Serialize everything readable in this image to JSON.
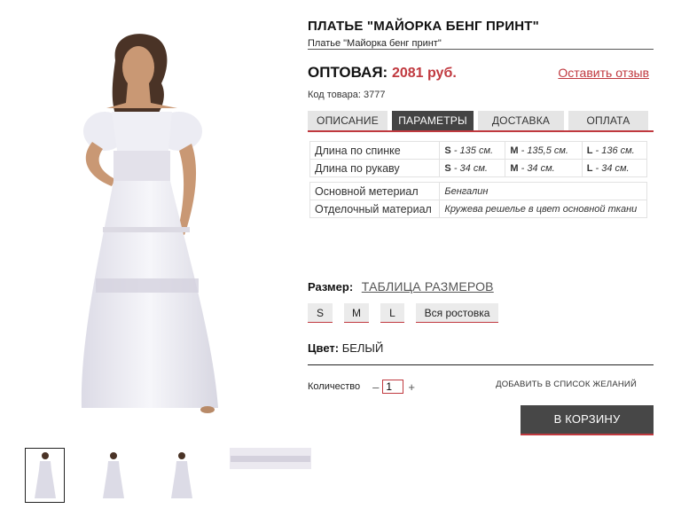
{
  "product": {
    "title": "ПЛАТЬЕ \"МАЙОРКА БЕНГ ПРИНТ\"",
    "subtitle": "Платье \"Майорка бенг принт\"",
    "price_label": "ОПТОВАЯ:",
    "price_value": "2081 руб.",
    "review_link": "Оставить отзыв",
    "sku": "Код товара: 3777"
  },
  "tabs": [
    "ОПИСАНИЕ",
    "ПАРАМЕТРЫ",
    "ДОСТАВКА",
    "ОПЛАТА"
  ],
  "params": {
    "measurements": [
      {
        "label": "Длина по спинке",
        "s": "135 см.",
        "m": "135,5 см.",
        "l": "136 см."
      },
      {
        "label": "Длина по рукаву",
        "s": "34 см.",
        "m": "34 см.",
        "l": "34 см."
      }
    ],
    "size_letters": {
      "s": "S",
      "m": "M",
      "l": "L"
    },
    "materials": [
      {
        "label": "Основной метериал",
        "value": "Бенгалин"
      },
      {
        "label": "Отделочный материал",
        "value": "Кружева решелье в цвет основной ткани"
      }
    ]
  },
  "size": {
    "label": "Размер:",
    "table_link": "ТАБЛИЦА РАЗМЕРОВ",
    "options": [
      "S",
      "M",
      "L",
      "Вся ростовка"
    ]
  },
  "color": {
    "label": "Цвет:",
    "value": "БЕЛЫЙ"
  },
  "quantity": {
    "label": "Количество",
    "minus": "–",
    "value": "1",
    "plus": "+"
  },
  "wishlist": "ДОБАВИТЬ В СПИСОК ЖЕЛАНИЙ",
  "cart_button": "В КОРЗИНУ",
  "colors": {
    "accent": "#c0393f",
    "dark": "#444444",
    "tab_bg": "#e5e5e5"
  }
}
